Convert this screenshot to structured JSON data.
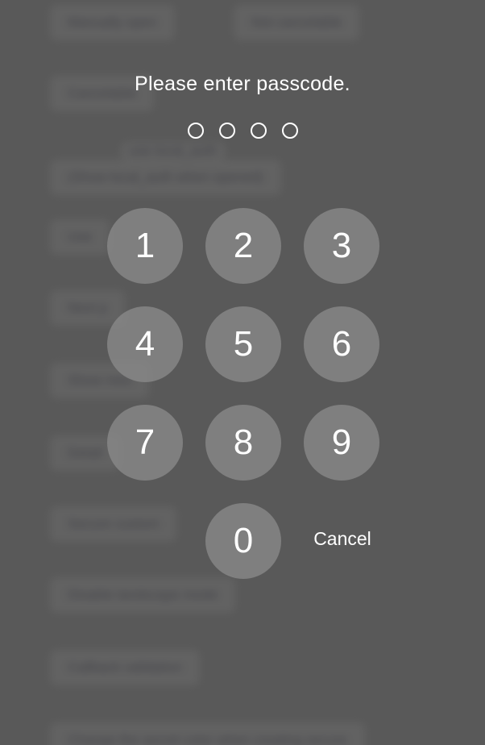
{
  "background_rows": [
    "Manually open",
    "Not cancelable",
    "Cancelable",
    "use local_auth",
    "(Show local_auth when opened)",
    "Use",
    "Next p",
    "Show mes",
    "Detail",
    "Secure custom",
    "Disable landscape mode",
    "Callback validation",
    "Change the secret color when creating secure"
  ],
  "passcode": {
    "prompt": "Please enter passcode.",
    "digit_count": 4,
    "dot_color": "#FFFFFF",
    "keys": [
      "1",
      "2",
      "3",
      "4",
      "5",
      "6",
      "7",
      "8",
      "9",
      "0"
    ],
    "cancel_label": "Cancel"
  },
  "colors": {
    "overlay": "#595959",
    "key_fill": "#8C8C8C",
    "text": "#FFFFFF"
  }
}
